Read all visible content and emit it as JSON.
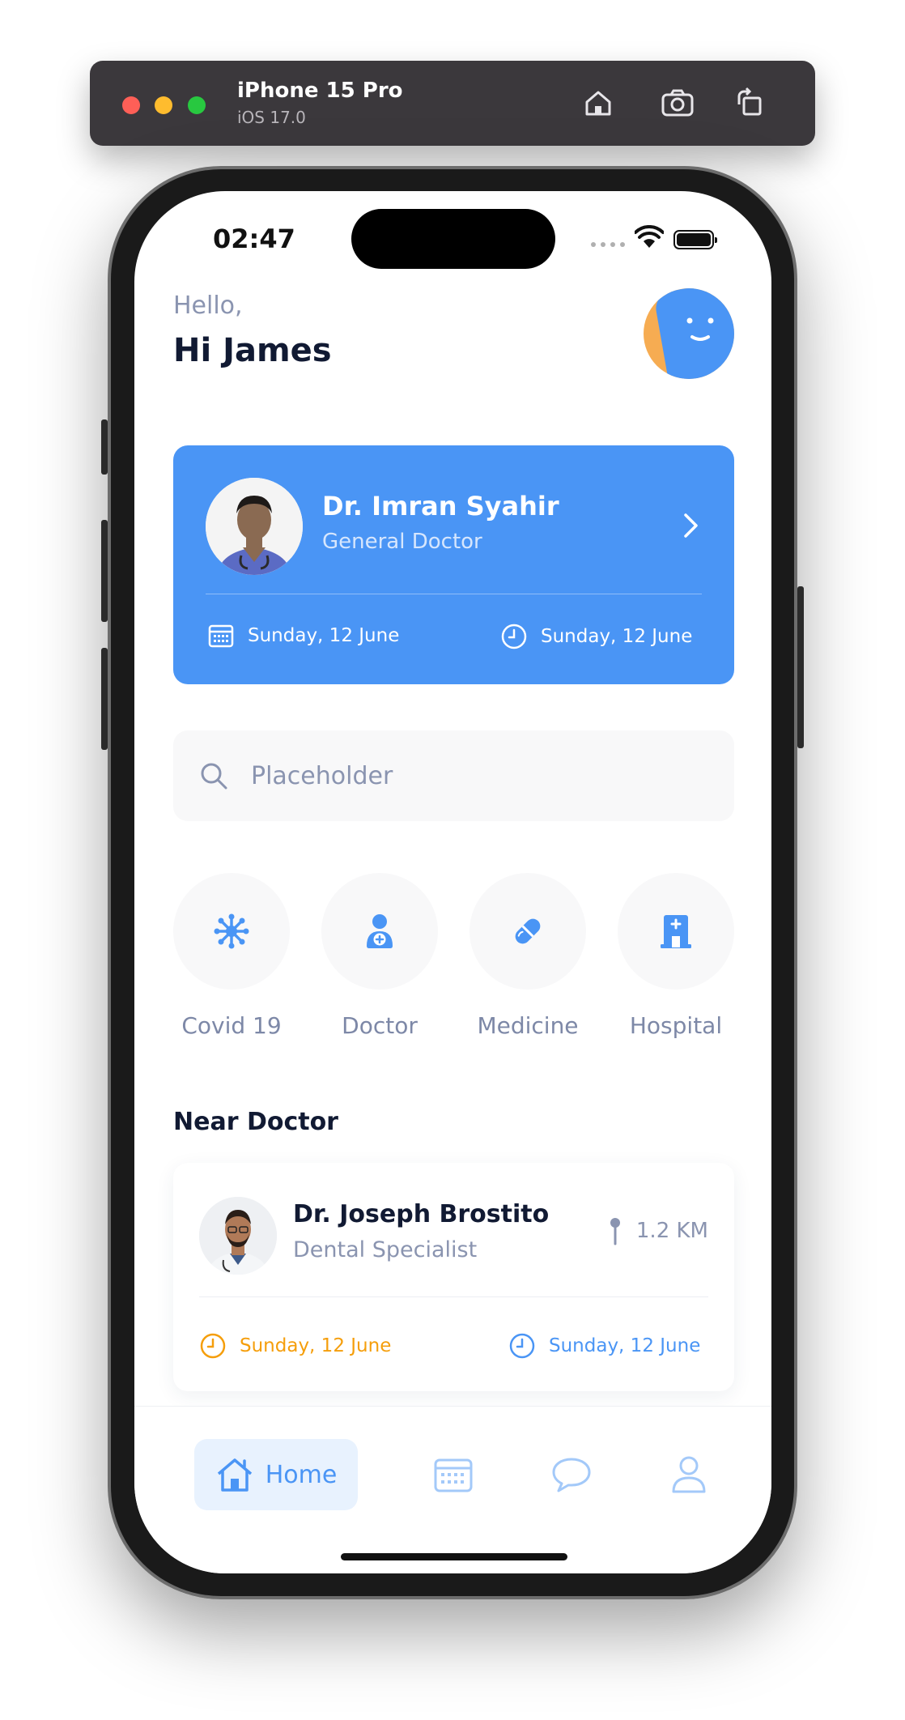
{
  "simulator": {
    "device_name": "iPhone 15 Pro",
    "os_version": "iOS 17.0"
  },
  "status_bar": {
    "time": "02:47"
  },
  "greeting": {
    "hello": "Hello,",
    "name": "Hi James"
  },
  "appointment": {
    "doctor_name": "Dr. Imran Syahir",
    "doctor_role": "General Doctor",
    "date_label": "Sunday, 12 June",
    "time_label": "Sunday, 12 June"
  },
  "search": {
    "placeholder": "Placeholder",
    "value": ""
  },
  "categories": [
    {
      "label": "Covid 19",
      "icon": "virus-icon"
    },
    {
      "label": "Doctor",
      "icon": "doctor-icon"
    },
    {
      "label": "Medicine",
      "icon": "pill-icon"
    },
    {
      "label": "Hospital",
      "icon": "hospital-icon"
    }
  ],
  "near_doctor": {
    "section_title": "Near Doctor",
    "doctors": [
      {
        "name": "Dr. Joseph Brostito",
        "specialty": "Dental Specialist",
        "distance": "1.2 KM",
        "time_left": "Sunday, 12 June",
        "time_right": "Sunday, 12 June"
      }
    ]
  },
  "tabbar": {
    "home_label": "Home"
  },
  "colors": {
    "primary": "#4a95f5",
    "accent_orange": "#f59e0b",
    "text_dark": "#111a33",
    "text_muted": "#8a94b0",
    "surface": "#f8f8f9"
  }
}
